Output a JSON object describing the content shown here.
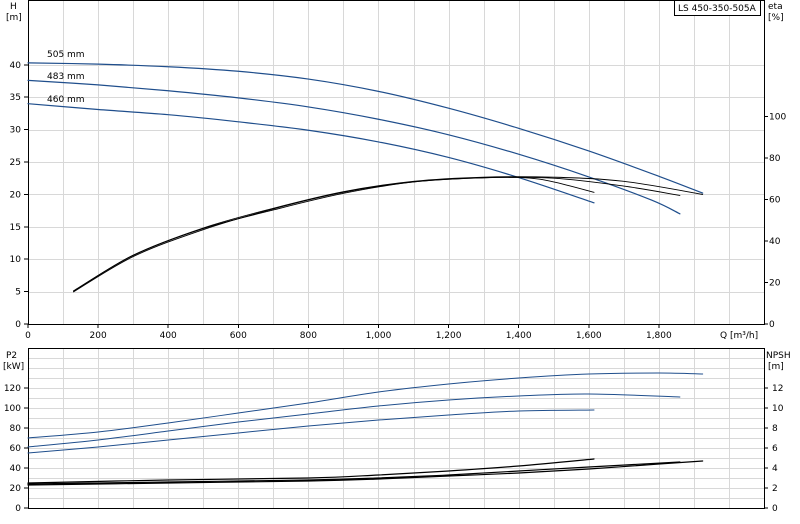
{
  "model_label": "LS 450-350-505A",
  "colors": {
    "curve_blue": "#1f4e8c",
    "curve_black": "#000000"
  },
  "chart_data": [
    {
      "id": "qh",
      "type": "line",
      "title": "",
      "xlabel": "Q [m³/h]",
      "ylabel_left": [
        "H",
        "[m]"
      ],
      "ylabel_right": [
        "eta",
        "[%]"
      ],
      "xlim": [
        0,
        2100
      ],
      "ylim": [
        0,
        50
      ],
      "ylim_right": [
        0,
        156.25
      ],
      "x_ticks": [
        0,
        200,
        400,
        600,
        800,
        1000,
        1200,
        1400,
        1600,
        1800
      ],
      "x_tick_labels": [
        "0",
        "200",
        "400",
        "600",
        "800",
        "1,000",
        "1,200",
        "1,400",
        "1,600",
        "1,800"
      ],
      "y_ticks": [
        0,
        5,
        10,
        15,
        20,
        25,
        30,
        35,
        40
      ],
      "y_tick_labels": [
        "0",
        "5",
        "10",
        "15",
        "20",
        "25",
        "30",
        "35",
        "40"
      ],
      "y2_ticks": [
        0,
        20,
        40,
        60,
        80,
        100
      ],
      "y2_tick_labels": [
        "0",
        "20",
        "40",
        "60",
        "80",
        "100"
      ],
      "grid": true,
      "head_series": [
        {
          "name": "505 mm",
          "color": "#1f4e8c",
          "x": [
            0,
            200,
            400,
            600,
            800,
            1000,
            1200,
            1400,
            1600,
            1800,
            1925
          ],
          "y": [
            40.3,
            40.1,
            39.7,
            39.0,
            37.8,
            35.9,
            33.3,
            30.2,
            26.7,
            22.8,
            20.2
          ]
        },
        {
          "name": "483 mm",
          "color": "#1f4e8c",
          "x": [
            0,
            200,
            400,
            600,
            800,
            1000,
            1200,
            1400,
            1600,
            1780,
            1860
          ],
          "y": [
            37.6,
            36.9,
            36.0,
            34.9,
            33.5,
            31.6,
            29.2,
            26.2,
            22.7,
            19.1,
            17.0
          ]
        },
        {
          "name": "460 mm",
          "color": "#1f4e8c",
          "x": [
            0,
            200,
            400,
            600,
            800,
            1000,
            1200,
            1400,
            1615
          ],
          "y": [
            34.0,
            33.1,
            32.3,
            31.2,
            29.9,
            28.1,
            25.7,
            22.6,
            18.7
          ]
        }
      ],
      "efficiency_series": [
        {
          "color": "#000000",
          "x": [
            130,
            300,
            500,
            700,
            900,
            1100,
            1300,
            1420,
            1500,
            1615
          ],
          "y": [
            16.0,
            33.0,
            46.0,
            55.0,
            63.0,
            68.5,
            70.5,
            70.5,
            68.5,
            63.5
          ]
        },
        {
          "color": "#000000",
          "x": [
            130,
            300,
            500,
            700,
            900,
            1100,
            1300,
            1500,
            1700,
            1860
          ],
          "y": [
            15.5,
            32.5,
            45.5,
            55.5,
            63.5,
            68.5,
            70.5,
            70.3,
            66.5,
            62.0
          ]
        },
        {
          "color": "#000000",
          "x": [
            130,
            300,
            500,
            700,
            900,
            1100,
            1300,
            1500,
            1700,
            1925
          ],
          "y": [
            15.8,
            33.2,
            46.3,
            55.8,
            63.8,
            68.8,
            70.8,
            70.8,
            68.8,
            62.5
          ]
        }
      ]
    },
    {
      "id": "power_npsh",
      "type": "line",
      "title": "",
      "xlabel": "",
      "ylabel_left": [
        "P2",
        "[kW]"
      ],
      "ylabel_right": [
        "NPSH",
        "[m]"
      ],
      "xlim": [
        0,
        2100
      ],
      "ylim": [
        0,
        160
      ],
      "ylim_right": [
        0,
        16
      ],
      "y_ticks": [
        0,
        20,
        40,
        60,
        80,
        100,
        120
      ],
      "y_tick_labels": [
        "0",
        "20",
        "40",
        "60",
        "80",
        "100",
        "120"
      ],
      "y2_ticks": [
        0,
        2,
        4,
        6,
        8,
        10,
        12
      ],
      "y2_tick_labels": [
        "0",
        "2",
        "4",
        "6",
        "8",
        "10",
        "12"
      ],
      "grid": true,
      "power_series": [
        {
          "color": "#1f4e8c",
          "x": [
            0,
            200,
            400,
            600,
            800,
            1000,
            1200,
            1400,
            1600,
            1800,
            1925
          ],
          "y": [
            70,
            76,
            85,
            95,
            105,
            116,
            124,
            130,
            134,
            135,
            134
          ]
        },
        {
          "color": "#1f4e8c",
          "x": [
            0,
            200,
            400,
            600,
            800,
            1000,
            1200,
            1400,
            1600,
            1860
          ],
          "y": [
            61,
            68,
            77,
            86,
            94,
            102,
            108,
            112,
            114,
            111
          ]
        },
        {
          "color": "#1f4e8c",
          "x": [
            0,
            200,
            400,
            600,
            800,
            1000,
            1200,
            1400,
            1615
          ],
          "y": [
            55,
            61,
            68,
            75,
            82,
            88,
            93,
            97,
            98
          ]
        }
      ],
      "npsh_series": [
        {
          "color": "#000000",
          "x": [
            0,
            400,
            800,
            1000,
            1200,
            1400,
            1615
          ],
          "y": [
            2.5,
            2.8,
            3.0,
            3.3,
            3.7,
            4.2,
            4.9
          ]
        },
        {
          "color": "#000000",
          "x": [
            0,
            400,
            800,
            1000,
            1200,
            1400,
            1600,
            1860
          ],
          "y": [
            2.4,
            2.6,
            2.8,
            3.0,
            3.3,
            3.7,
            4.1,
            4.6
          ]
        },
        {
          "color": "#000000",
          "x": [
            0,
            400,
            800,
            1000,
            1200,
            1400,
            1600,
            1800,
            1925
          ],
          "y": [
            2.3,
            2.5,
            2.7,
            2.9,
            3.2,
            3.5,
            3.9,
            4.4,
            4.7
          ]
        }
      ]
    }
  ]
}
